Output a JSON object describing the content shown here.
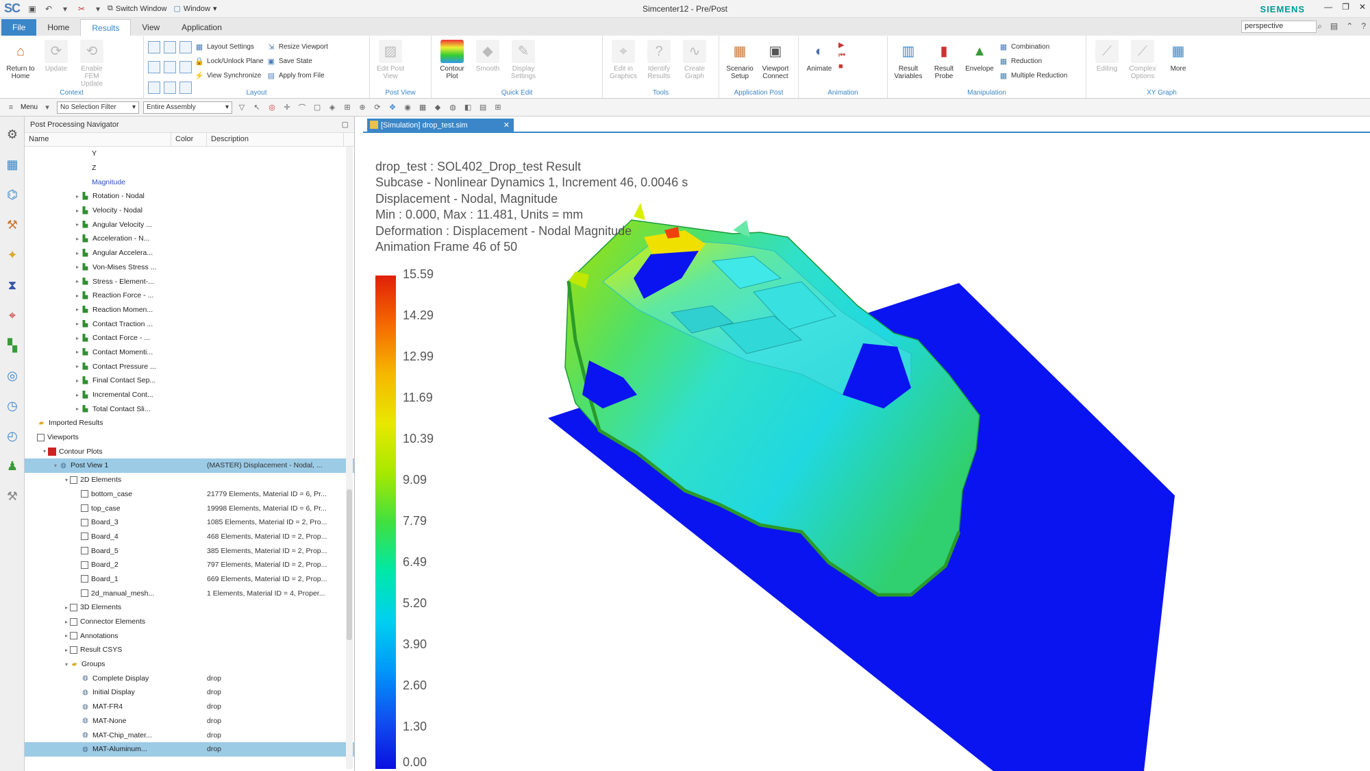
{
  "titlebar": {
    "logo": "SC",
    "switch_window": "Switch Window",
    "window_menu": "Window",
    "title": "Simcenter12 - Pre/Post",
    "brand": "SIEMENS"
  },
  "tabs": [
    "File",
    "Home",
    "Results",
    "View",
    "Application"
  ],
  "active_tab": "Results",
  "command_search": {
    "value": "perspective"
  },
  "ribbon": {
    "context": {
      "label": "Context",
      "return_home": "Return to Home",
      "update": "Update",
      "enable_fem_update": "Enable FEM Update"
    },
    "layout": {
      "label": "Layout",
      "layout_settings": "Layout Settings",
      "lock_unlock_plane": "Lock/Unlock Plane",
      "view_synchronize": "View Synchronize",
      "resize_viewport": "Resize Viewport",
      "save_state": "Save State",
      "apply_from_file": "Apply from File"
    },
    "post_view": {
      "label": "Post View",
      "edit_post_view": "Edit Post View"
    },
    "quick_edit": {
      "label": "Quick Edit",
      "contour_plot": "Contour Plot",
      "smooth": "Smooth",
      "display_settings": "Display Settings"
    },
    "tools": {
      "label": "Tools",
      "edit_in_graphics": "Edit in Graphics",
      "identify_results": "Identify Results",
      "create_graph": "Create Graph"
    },
    "application_post": {
      "label": "Application Post",
      "scenario_setup": "Scenario Setup",
      "viewport_connect": "Viewport Connect"
    },
    "animation": {
      "label": "Animation",
      "animate": "Animate"
    },
    "manipulation": {
      "label": "Manipulation",
      "result_variables": "Result Variables",
      "result_probe": "Result Probe",
      "envelope": "Envelope",
      "combination": "Combination",
      "reduction": "Reduction",
      "multiple_reduction": "Multiple Reduction"
    },
    "xy_graph": {
      "label": "XY Graph",
      "editing": "Editing",
      "complex_options": "Complex Options",
      "more": "More"
    }
  },
  "selection_bar": {
    "menu": "Menu",
    "filter": "No Selection Filter",
    "scope": "Entire Assembly"
  },
  "navigator": {
    "title": "Post Processing Navigator",
    "columns": {
      "name": "Name",
      "color": "Color",
      "description": "Description"
    },
    "rows": [
      {
        "indent": 5,
        "icon": "none",
        "label": "Y",
        "desc": ""
      },
      {
        "indent": 5,
        "icon": "none",
        "label": "Z",
        "desc": ""
      },
      {
        "indent": 5,
        "icon": "none",
        "label": "Magnitude",
        "desc": "",
        "blue": true
      },
      {
        "indent": 4,
        "icon": "green",
        "expand": "+",
        "label": "Rotation - Nodal",
        "desc": ""
      },
      {
        "indent": 4,
        "icon": "green",
        "expand": "+",
        "label": "Velocity - Nodal",
        "desc": ""
      },
      {
        "indent": 4,
        "icon": "green",
        "expand": "+",
        "label": "Angular Velocity ...",
        "desc": ""
      },
      {
        "indent": 4,
        "icon": "green",
        "expand": "+",
        "label": "Acceleration - N...",
        "desc": ""
      },
      {
        "indent": 4,
        "icon": "green",
        "expand": "+",
        "label": "Angular Accelera...",
        "desc": ""
      },
      {
        "indent": 4,
        "icon": "green",
        "expand": "+",
        "label": "Von-Mises Stress ...",
        "desc": ""
      },
      {
        "indent": 4,
        "icon": "green",
        "expand": "+",
        "label": "Stress - Element-...",
        "desc": ""
      },
      {
        "indent": 4,
        "icon": "green",
        "expand": "+",
        "label": "Reaction Force - ...",
        "desc": ""
      },
      {
        "indent": 4,
        "icon": "green",
        "expand": "+",
        "label": "Reaction Momen...",
        "desc": ""
      },
      {
        "indent": 4,
        "icon": "green",
        "expand": "+",
        "label": "Contact Traction ...",
        "desc": ""
      },
      {
        "indent": 4,
        "icon": "green",
        "expand": "+",
        "label": "Contact Force - ...",
        "desc": ""
      },
      {
        "indent": 4,
        "icon": "green",
        "expand": "+",
        "label": "Contact Momenti...",
        "desc": ""
      },
      {
        "indent": 4,
        "icon": "green",
        "expand": "+",
        "label": "Contact Pressure ...",
        "desc": ""
      },
      {
        "indent": 4,
        "icon": "green",
        "expand": "+",
        "label": "Final Contact Sep...",
        "desc": ""
      },
      {
        "indent": 4,
        "icon": "green",
        "expand": "+",
        "label": "Incremental Cont...",
        "desc": ""
      },
      {
        "indent": 4,
        "icon": "green",
        "expand": "+",
        "label": "Total Contact Sli...",
        "desc": ""
      },
      {
        "indent": 0,
        "icon": "folder",
        "label": "Imported Results",
        "desc": ""
      },
      {
        "indent": 0,
        "icon": "box",
        "label": "Viewports",
        "desc": ""
      },
      {
        "indent": 1,
        "icon": "redbox",
        "expand": "-",
        "label": "Contour Plots",
        "desc": ""
      },
      {
        "indent": 2,
        "icon": "grp",
        "expand": "-",
        "label": "Post View 1",
        "desc": "(MASTER) Displacement - Nodal, ...",
        "selected": true
      },
      {
        "indent": 3,
        "icon": "box",
        "expand": "-",
        "label": "2D Elements",
        "desc": ""
      },
      {
        "indent": 4,
        "icon": "box",
        "label": "bottom_case",
        "desc": "21779 Elements, Material ID = 6, Pr..."
      },
      {
        "indent": 4,
        "icon": "box",
        "label": "top_case",
        "desc": "19998 Elements, Material ID = 6, Pr..."
      },
      {
        "indent": 4,
        "icon": "box",
        "label": "Board_3",
        "desc": "1085 Elements, Material ID = 2, Pro..."
      },
      {
        "indent": 4,
        "icon": "box",
        "label": "Board_4",
        "desc": "468 Elements, Material ID = 2, Prop..."
      },
      {
        "indent": 4,
        "icon": "box",
        "label": "Board_5",
        "desc": "385 Elements, Material ID = 2, Prop..."
      },
      {
        "indent": 4,
        "icon": "box",
        "label": "Board_2",
        "desc": "797 Elements, Material ID = 2, Prop..."
      },
      {
        "indent": 4,
        "icon": "box",
        "label": "Board_1",
        "desc": "669 Elements, Material ID = 2, Prop..."
      },
      {
        "indent": 4,
        "icon": "box",
        "label": "2d_manual_mesh...",
        "desc": "1 Elements, Material ID = 4, Proper..."
      },
      {
        "indent": 3,
        "icon": "box",
        "expand": "+",
        "label": "3D Elements",
        "desc": ""
      },
      {
        "indent": 3,
        "icon": "box",
        "expand": "+",
        "label": "Connector Elements",
        "desc": ""
      },
      {
        "indent": 3,
        "icon": "box",
        "expand": "+",
        "label": "Annotations",
        "desc": ""
      },
      {
        "indent": 3,
        "icon": "box",
        "expand": "+",
        "label": "Result CSYS",
        "desc": ""
      },
      {
        "indent": 3,
        "icon": "folder",
        "expand": "-",
        "label": "Groups",
        "desc": ""
      },
      {
        "indent": 4,
        "icon": "grp",
        "label": "Complete Display",
        "desc": "drop"
      },
      {
        "indent": 4,
        "icon": "grp",
        "label": "Initial Display",
        "desc": "drop"
      },
      {
        "indent": 4,
        "icon": "grp",
        "label": "MAT-FR4",
        "desc": "drop"
      },
      {
        "indent": 4,
        "icon": "grp",
        "label": "MAT-None",
        "desc": "drop"
      },
      {
        "indent": 4,
        "icon": "grp",
        "label": "MAT-Chip_mater...",
        "desc": "drop"
      },
      {
        "indent": 4,
        "icon": "grp",
        "label": "MAT-Aluminum...",
        "desc": "drop",
        "selected": true
      }
    ]
  },
  "graphics": {
    "tab_label": "[Simulation] drop_test.sim",
    "annotation": [
      "drop_test : SOL402_Drop_test Result",
      "Subcase - Nonlinear Dynamics 1, Increment 46, 0.0046 s",
      "Displacement - Nodal, Magnitude",
      "Min : 0.000, Max : 11.481, Units = mm",
      "Deformation : Displacement - Nodal Magnitude",
      "Animation Frame 46 of 50"
    ],
    "legend": [
      "15.59",
      "14.29",
      "12.99",
      "11.69",
      "10.39",
      "9.09",
      "7.79",
      "6.49",
      "5.20",
      "3.90",
      "2.60",
      "1.30",
      "0.00"
    ]
  },
  "colors": {
    "accent": "#3a86c8",
    "brand": "#009999",
    "floor": "#0a14f0"
  }
}
